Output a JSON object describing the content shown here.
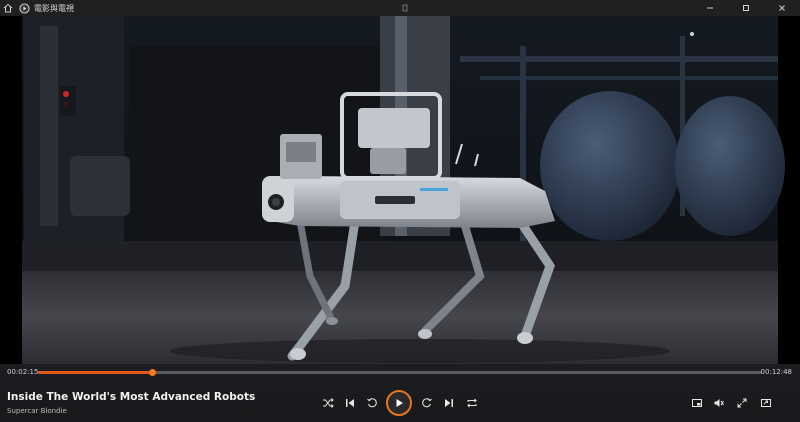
{
  "window": {
    "app_title": "電影與電視",
    "icons": {
      "back": "back-arrow-icon",
      "app": "movies-tv-icon",
      "minimize": "minimize-icon",
      "maximize": "maximize-icon",
      "close": "close-icon"
    }
  },
  "player": {
    "current_time": "00:02:15",
    "total_time": "00:12:48",
    "progress": 0.158,
    "title": "Inside The World's Most Advanced Robots",
    "artist": "Supercar Blondie",
    "accent_color": "#e8741f",
    "controls": [
      "shuffle-icon",
      "previous-icon",
      "rewind-10-icon",
      "play-icon",
      "forward-30-icon",
      "next-icon",
      "repeat-icon"
    ],
    "right_controls": [
      "mini-view-icon",
      "volume-icon",
      "fullscreen-icon",
      "more-icon"
    ]
  }
}
